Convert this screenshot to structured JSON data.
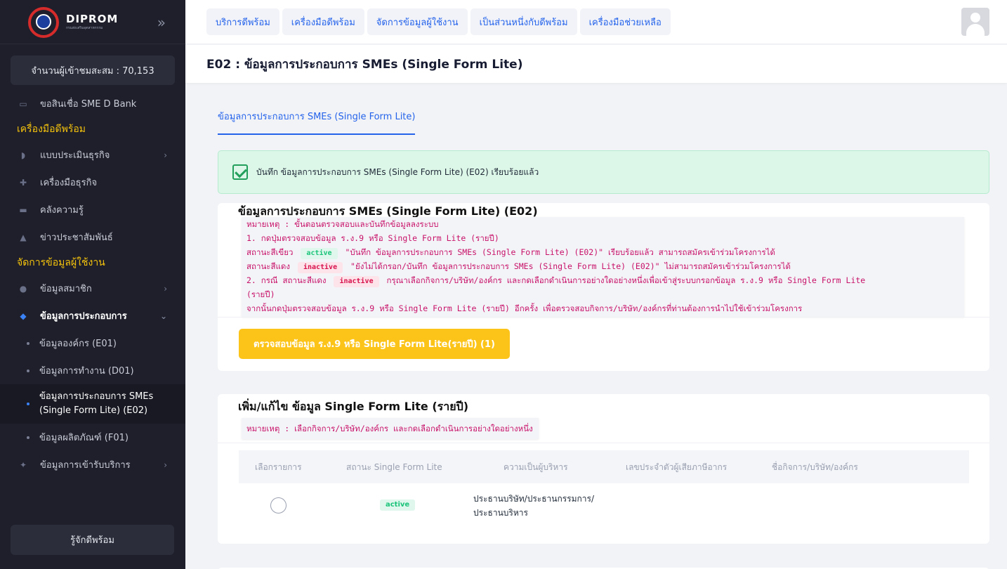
{
  "sidebar": {
    "logo_text": "DIPROM",
    "logo_subtext": "กรมส่งเสริมอุตสาหกรรม",
    "visitor_label": "จำนวนผู้เข้าชมสะสม : 70,153",
    "items": [
      {
        "label": "ขอสินเชื่อ SME D Bank",
        "icon": "bank-icon"
      },
      {
        "section": "เครื่องมือดีพร้อม"
      },
      {
        "label": "แบบประเมินธุรกิจ",
        "icon": "chart-icon"
      },
      {
        "label": "เครื่องมือธุรกิจ",
        "icon": "tools-icon"
      },
      {
        "label": "คลังความรู้",
        "icon": "book-icon"
      },
      {
        "label": "ข่าวประชาสัมพันธ์",
        "icon": "megaphone-icon"
      },
      {
        "section": "จัดการข้อมูลผู้ใช้งาน"
      },
      {
        "label": "ข้อมูลสมาชิก",
        "icon": "user-icon"
      },
      {
        "label": "ข้อมูลการประกอบการ",
        "icon": "diamond-icon"
      },
      {
        "label": "ข้อมูลองค์กร (E01)"
      },
      {
        "label": "ข้อมูลการทำงาน (D01)"
      },
      {
        "label": "ข้อมูลการประกอบการ SMEs (Single Form Lite) (E02)"
      },
      {
        "label": "ข้อมูลผลิตภัณฑ์ (F01)"
      },
      {
        "label": "ข้อมูลการเข้ารับบริการ",
        "icon": "service-icon"
      }
    ],
    "bottom_button": "รู้จักดีพร้อม"
  },
  "topbar": {
    "buttons": [
      "บริการดีพร้อม",
      "เครื่องมือดีพร้อม",
      "จัดการข้อมูลผู้ใช้งาน",
      "เป็นส่วนหนึ่งกับดีพร้อม",
      "เครื่องมือช่วยเหลือ"
    ]
  },
  "page": {
    "title": "E02 : ข้อมูลการประกอบการ SMEs (Single Form Lite)",
    "tab": "ข้อมูลการประกอบการ SMEs (Single Form Lite)",
    "alert": "บันทึก ข้อมูลการประกอบการ SMEs (Single Form Lite) (E02) เรียบร้อยแล้ว"
  },
  "card1": {
    "title": "ข้อมูลการประกอบการ SMEs (Single Form Lite) (E02)",
    "note_line1": "หมายเหตุ : ขั้นตอนตรวจสอบและบันทึกข้อมูลลงระบบ",
    "note_line2": "1. กดปุ่มตรวจสอบข้อมูล ร.ง.9 หรือ Single Form Lite (รายปี)",
    "note_line3_prefix": "สถานะสีเขียว",
    "badge_active": "active",
    "note_line3_suffix": "\"บันทึก ข้อมูลการประกอบการ SMEs (Single Form Lite) (E02)\" เรียบร้อยแล้ว สามารถสมัครเข้าร่วมโครงการได้",
    "note_line4_prefix": "สถานะสีแดง",
    "badge_inactive": "inactive",
    "note_line4_suffix": "\"ยังไม่ได้กรอก/บันทึก ข้อมูลการประกอบการ SMEs (Single Form Lite) (E02)\" ไม่สามารถสมัครเข้าร่วมโครงการได้",
    "note_line5_prefix": "2. กรณี สถานะสีแดง",
    "note_line5_suffix": "กรุณาเลือกกิจการ/บริษัท/องค์กร และกดเลือกดำเนินการอย่างใดอย่างหนึ่งเพื่อเข้าสู่ระบบกรอกข้อมูล ร.ง.9 หรือ Single Form Lite",
    "note_line6": "(รายปี)",
    "note_line7": "จากนั้นกดปุ่มตรวจสอบข้อมูล ร.ง.9 หรือ Single Form Lite (รายปี) อีกครั้ง เพื่อตรวจสอบกิจการ/บริษัท/องค์กรที่ท่านต้องการนำไปใช้เข้าร่วมโครงการ",
    "check_button": "ตรวจสอบข้อมูล ร.ง.9 หรือ Single Form Lite(รายปี) (1)"
  },
  "card2": {
    "title": "เพิ่ม/แก้ไข ข้อมูล Single Form Lite (รายปี)",
    "note": "หมายเหตุ : เลือกกิจการ/บริษัท/องค์กร และกดเลือกดำเนินการอย่างใดอย่างหนึ่ง",
    "columns": [
      "เลือกรายการ",
      "สถานะ Single Form Lite",
      "ความเป็นผู้บริหาร",
      "เลขประจำตัวผู้เสียภาษีอากร",
      "ชื่อกิจการ/บริษัท/องค์กร"
    ],
    "rows": [
      {
        "status": "active",
        "role": "ประธานบริษัท/ประธานกรรมการ/ประธานบริหาร",
        "tax_id": "",
        "company": ""
      }
    ]
  },
  "colors": {
    "accent": "#2563eb",
    "warning": "#fcc419",
    "success": "#22a05b",
    "sidebar_bg": "#1e1f2a",
    "section_title": "#f4c20d"
  }
}
